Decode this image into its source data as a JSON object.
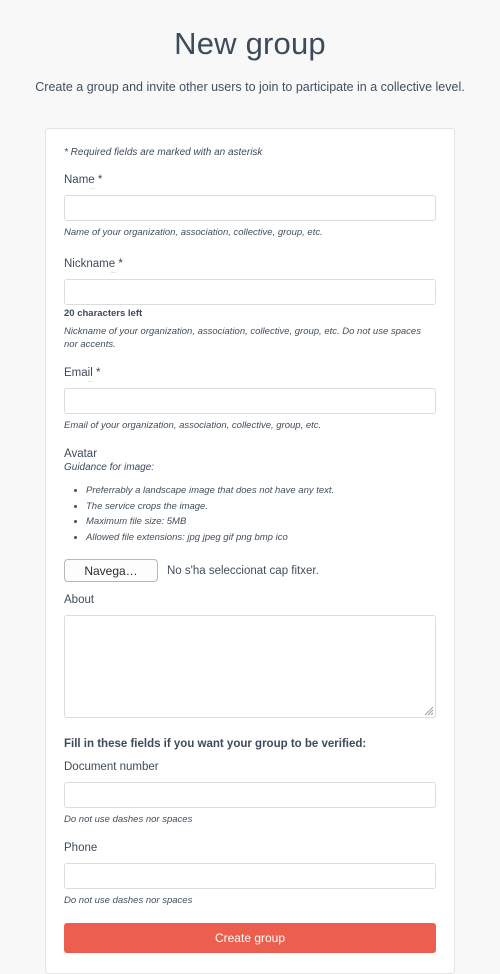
{
  "header": {
    "title": "New group",
    "subtitle": "Create a group and invite other users to join to participate in a collective level."
  },
  "form": {
    "required_note": "* Required fields are marked with an asterisk",
    "abbr_marker": "..",
    "name": {
      "label": "Name",
      "required_star": "*",
      "value": "",
      "help": "Name of your organization, association, collective, group, etc."
    },
    "nickname": {
      "label": "Nickname",
      "required_star": "*",
      "value": "",
      "counter": "20 characters left",
      "help": "Nickname of your organization, association, collective, group, etc. Do not use spaces nor accents."
    },
    "email": {
      "label": "Email",
      "required_star": "*",
      "value": "",
      "help": "Email of your organization, association, collective, group, etc."
    },
    "avatar": {
      "label": "Avatar",
      "guidance_title": "Guidance for image:",
      "guidance_items": [
        "Preferrably a landscape image that does not have any text.",
        "The service crops the image.",
        "Maximum file size: 5MB",
        "Allowed file extensions: jpg jpeg gif png bmp ico"
      ],
      "browse_button": "Navega…",
      "file_status": "No s'ha seleccionat cap fitxer."
    },
    "about": {
      "label": "About",
      "value": ""
    },
    "verified_section": {
      "heading": "Fill in these fields if you want your group to be verified:",
      "document_number": {
        "label": "Document number",
        "value": "",
        "help": "Do not use dashes nor spaces"
      },
      "phone": {
        "label": "Phone",
        "value": "",
        "help": "Do not use dashes nor spaces"
      }
    },
    "submit_label": "Create group"
  },
  "colors": {
    "accent": "#ec5f4f",
    "page_background": "#f8f8f8",
    "card_background": "#ffffff",
    "text": "#3e4b5b",
    "border": "#dcdcdc"
  }
}
